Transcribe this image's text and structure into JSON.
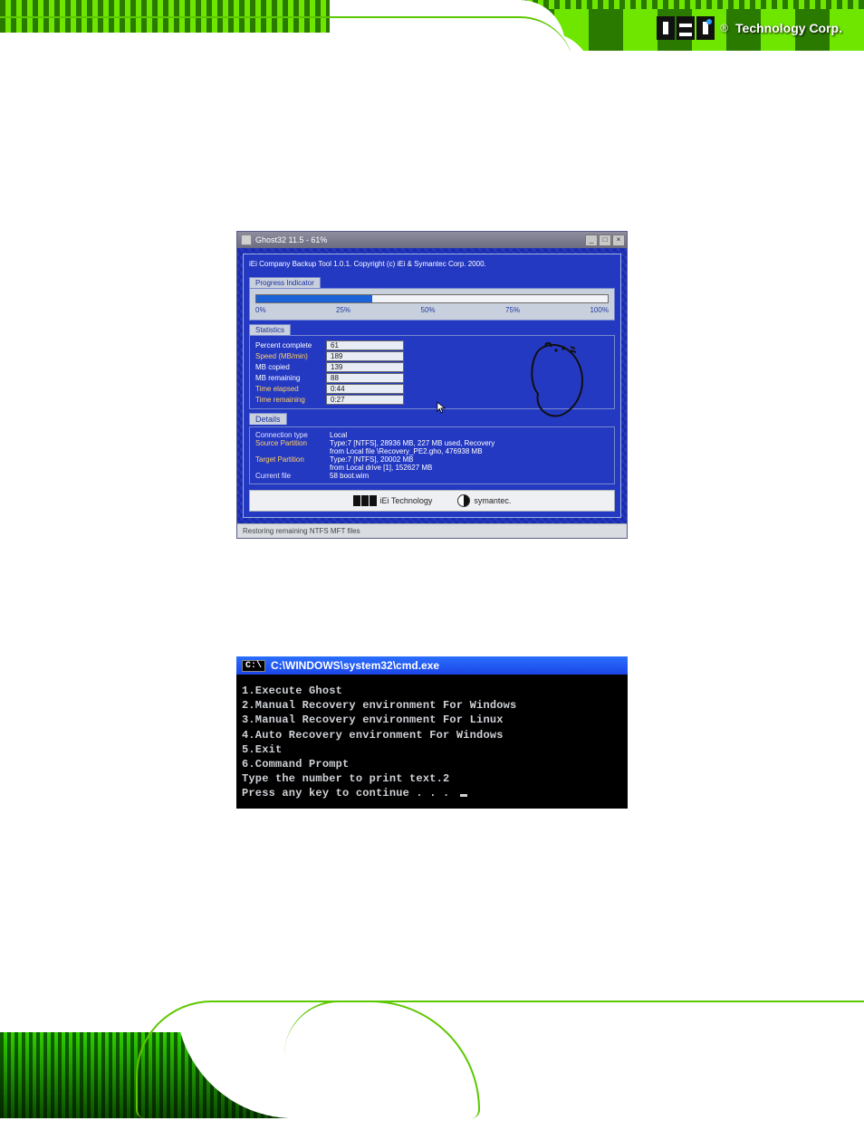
{
  "header": {
    "logo_text": "Technology Corp.",
    "logo_reg": "®"
  },
  "ghost": {
    "window_title": "Ghost32 11.5 - 61%",
    "inner_title": "iEi Company Backup Tool 1.0.1.   Copyright (c) iEi & Symantec Corp. 2000.",
    "progress_section_label": "Progress Indicator",
    "axis": {
      "p0": "0%",
      "p25": "25%",
      "p50": "50%",
      "p75": "75%",
      "p100": "100%"
    },
    "progress_percent": 33,
    "stats_section_label": "Statistics",
    "stats": {
      "percent_complete_label": "Percent complete",
      "percent_complete": "61",
      "speed_label": "Speed (MB/min)",
      "speed": "189",
      "mb_copied_label": "MB copied",
      "mb_copied": "139",
      "mb_remaining_label": "MB remaining",
      "mb_remaining": "88",
      "time_elapsed_label": "Time elapsed",
      "time_elapsed": "0:44",
      "time_remaining_label": "Time remaining",
      "time_remaining": "0:27"
    },
    "details_section_label": "Details",
    "details": {
      "conn_type_label": "Connection type",
      "conn_type": "Local",
      "source_label": "Source Partition",
      "source_line1": "Type:7 [NTFS], 28936 MB, 227 MB used, Recovery",
      "source_line2": "from Local file \\Recovery_PE2.gho, 476938 MB",
      "target_label": "Target Partition",
      "target_line1": "Type:7 [NTFS], 20002 MB",
      "target_line2": "from Local drive [1], 152627 MB",
      "current_file_label": "Current file",
      "current_file": "58 boot.wim"
    },
    "footer_logos": {
      "iei": "iEi Technology",
      "symantec": "symantec."
    },
    "statusbar": "Restoring remaining NTFS MFT files"
  },
  "cmd": {
    "title_prefix": "C:\\",
    "title_path": "C:\\WINDOWS\\system32\\cmd.exe",
    "lines": {
      "l1": "1.Execute Ghost",
      "l2": "2.Manual Recovery environment For Windows",
      "l3": "3.Manual Recovery environment For Linux",
      "l4": "4.Auto Recovery environment For Windows",
      "l5": "5.Exit",
      "l6": "6.Command Prompt",
      "l7": "Type the number to print text.2",
      "l8": "Press any key to continue . . . "
    }
  }
}
